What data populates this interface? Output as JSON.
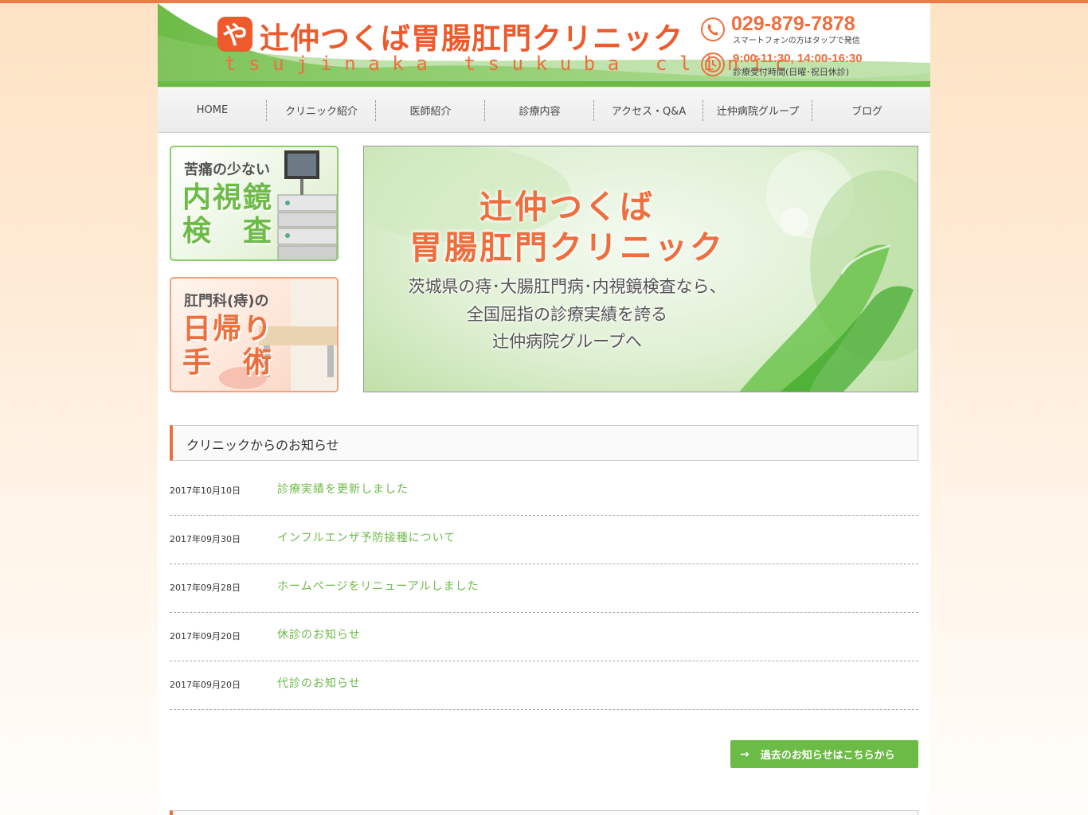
{
  "header": {
    "title": "辻仲つくば胃腸肛門クリニック",
    "subtitle": "tsujinaka tsukuba clinic",
    "logo_glyph": "や",
    "phone": "029-879-7878",
    "phone_note": "スマートフォンの方はタップで発信",
    "hours": "9:00-11:30, 14:00-16:30",
    "hours_note": "診療受付時間(日曜･祝日休診)",
    "icons": [
      "phone-icon",
      "clock-icon"
    ]
  },
  "nav": {
    "items": [
      {
        "label": "HOME"
      },
      {
        "label": "クリニック紹介"
      },
      {
        "label": "医師紹介"
      },
      {
        "label": "診療内容"
      },
      {
        "label": "アクセス・Q&A"
      },
      {
        "label": "辻仲病院グループ"
      },
      {
        "label": "ブログ"
      }
    ]
  },
  "banners": {
    "endoscopy": {
      "small": "苦痛の少ない",
      "line1": "内視鏡",
      "line2": "検　査"
    },
    "surgery": {
      "small": "肛門科(痔)の",
      "line1": "日帰り",
      "line2": "手　術"
    }
  },
  "hero": {
    "title_line1": "辻仲つくば",
    "title_line2": "胃腸肛門クリニック",
    "text_line1": "茨城県の痔･大腸肛門病･内視鏡検査なら、",
    "text_line2": "全国屈指の診療実績を誇る",
    "text_line3": "辻仲病院グループへ"
  },
  "news": {
    "heading": "クリニックからのお知らせ",
    "items": [
      {
        "date": "2017年10月10日",
        "title": "診療実績を更新しました"
      },
      {
        "date": "2017年09月30日",
        "title": "インフルエンザ予防接種について"
      },
      {
        "date": "2017年09月28日",
        "title": "ホームページをリニューアルしました"
      },
      {
        "date": "2017年09月20日",
        "title": "休診のお知らせ"
      },
      {
        "date": "2017年09月20日",
        "title": "代診のお知らせ"
      }
    ],
    "more_arrow": "→",
    "more_label": "過去のお知らせはこちらから"
  },
  "colors": {
    "accent": "#ee6f3d",
    "green": "#6dbb47",
    "topbar": "#f07a45"
  }
}
